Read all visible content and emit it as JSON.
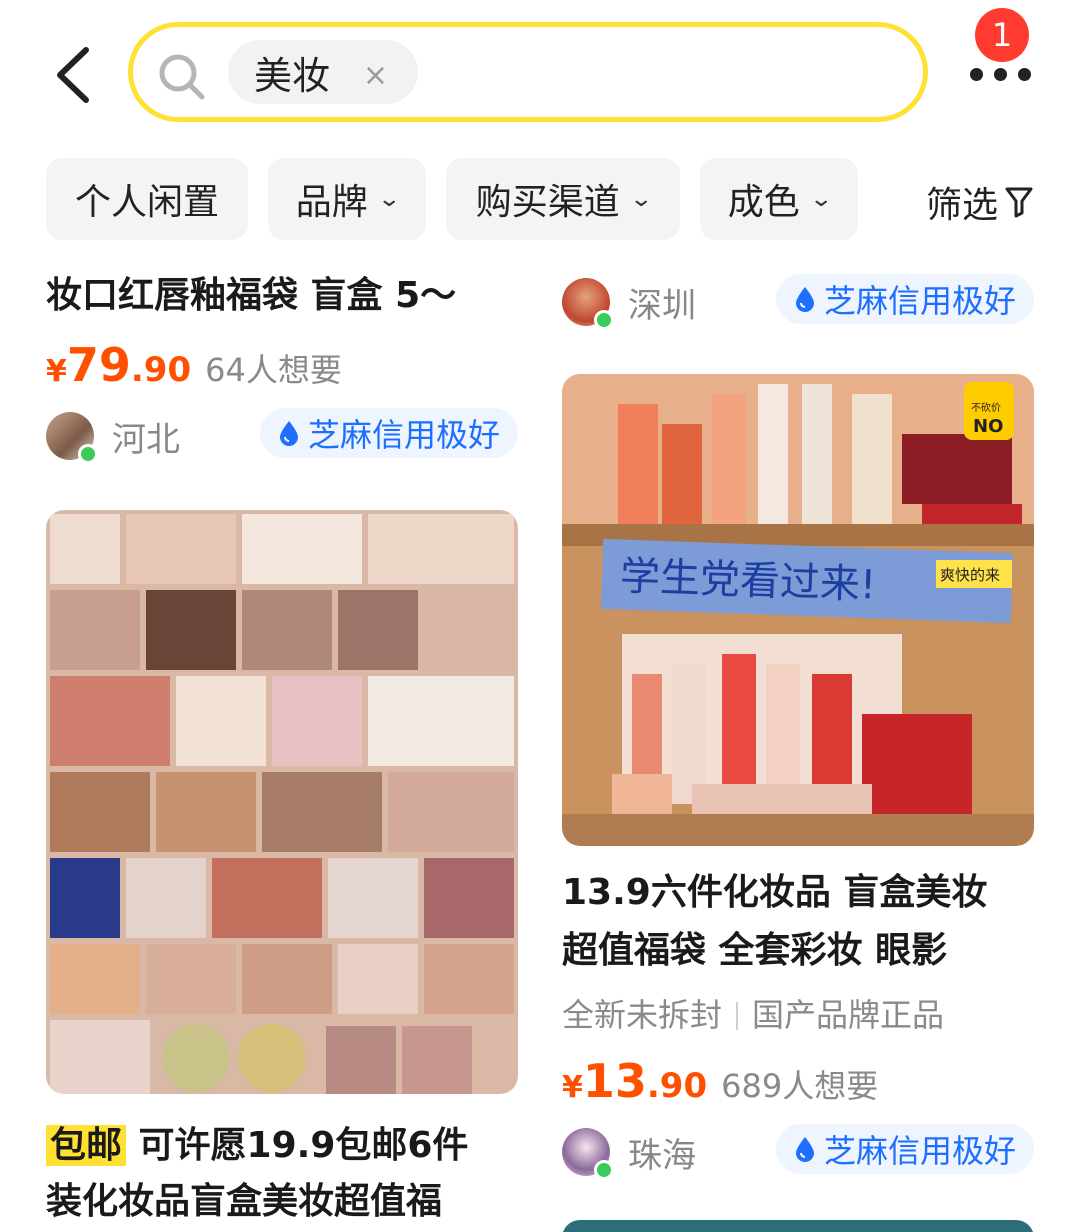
{
  "header": {
    "search_keyword": "美妆",
    "clear_symbol": "×",
    "notification_count": "1"
  },
  "filters": [
    {
      "label": "个人闲置"
    },
    {
      "label": "品牌",
      "chev": "⌄"
    },
    {
      "label": "购买渠道",
      "chev": "⌄"
    },
    {
      "label": "成色",
      "chev": "⌄"
    }
  ],
  "filter_button": {
    "label": "筛选",
    "icon": "funnel-icon"
  },
  "left_items": [
    {
      "title": "妆口红唇釉福袋 盲盒 5～",
      "price_symbol": "¥",
      "price_int": "79",
      "price_dec": ".90",
      "wants": "64人想要",
      "city": "河北",
      "credit": "芝麻信用极好"
    },
    {
      "badge": "包邮",
      "title_line1": " 可许愿19.9包邮6件",
      "title_line2": "装化妆品盲盒美妆超值福",
      "image": "eyeshadow-palettes-image"
    }
  ],
  "right_items": [
    {
      "city": "深圳",
      "credit": "芝麻信用极好"
    },
    {
      "image": "cosmetics-shelf-image",
      "image_sign": "学生党看过来!",
      "image_sticker_top": "不砍价",
      "image_sticker_no": "NO",
      "image_tag": "爽快的来",
      "title_line1": "13.9六件化妆品  盲盒美妆",
      "title_line2": "超值福袋  全套彩妆 眼影",
      "tags": [
        "全新未拆封",
        "国产品牌正品"
      ],
      "price_symbol": "¥",
      "price_int": "13",
      "price_dec": ".90",
      "wants": "689人想要",
      "city2": "珠海",
      "credit2": "芝麻信用极好"
    }
  ],
  "colors": {
    "accent_yellow": "#ffe033",
    "price_orange": "#ff5000",
    "credit_blue": "#1f6fff",
    "badge_red": "#ff3b30"
  }
}
